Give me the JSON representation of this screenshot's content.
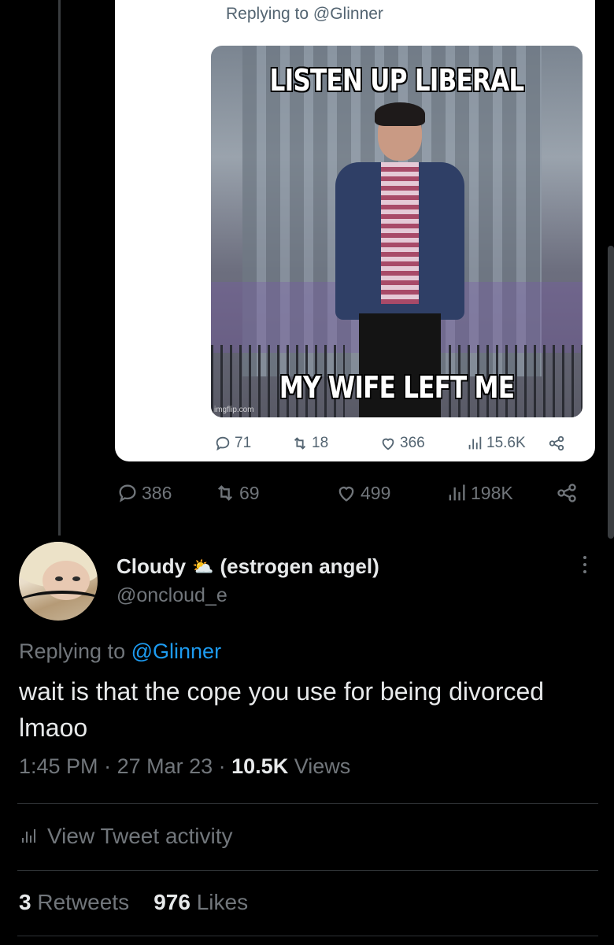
{
  "quoted_tweet": {
    "replying_prefix": "Replying to",
    "replying_handle": "@Glinner",
    "meme": {
      "top_caption": "LISTEN UP LIBERAL",
      "bottom_caption": "MY WIFE LEFT ME",
      "watermark": "imgflip.com"
    },
    "stats": {
      "replies": "71",
      "retweets": "18",
      "likes": "366",
      "views": "15.6K"
    }
  },
  "main_stats": {
    "replies": "386",
    "retweets": "69",
    "likes": "499",
    "views": "198K"
  },
  "reply": {
    "display_name": "Cloudy",
    "emoji": "⛅",
    "name_suffix": "(estrogen angel)",
    "handle": "@oncloud_e",
    "replying_prefix": "Replying to",
    "replying_handle": "@Glinner",
    "text": "wait is that the cope you use for being divorced lmaoo",
    "time": "1:45 PM",
    "date": "27 Mar 23",
    "views_count": "10.5K",
    "views_label": "Views",
    "activity_label": "View Tweet activity",
    "retweets_count": "3",
    "retweets_label": "Retweets",
    "likes_count": "976",
    "likes_label": "Likes"
  },
  "colors": {
    "link": "#1d9bf0",
    "muted": "#71767b",
    "background": "#000000"
  }
}
